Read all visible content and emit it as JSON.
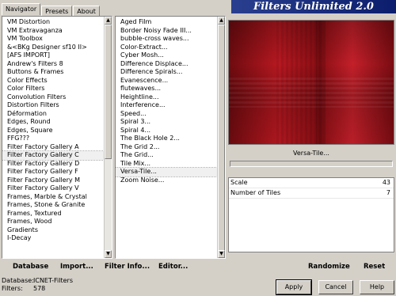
{
  "tabs": [
    "Navigator",
    "Presets",
    "About"
  ],
  "app_title": "Filters Unlimited 2.0",
  "categories": [
    "VM Distortion",
    "VM Extravaganza",
    "VM Toolbox",
    "&<BKg Designer sf10 II>",
    "[AFS IMPORT]",
    "Andrew's Filters 8",
    "Buttons & Frames",
    "Color Effects",
    "Color Filters",
    "Convolution Filters",
    "Distortion Filters",
    "Déformation",
    "Edges, Round",
    "Edges, Square",
    "FFG???",
    "Filter Factory Gallery A",
    "Filter Factory Gallery C",
    "Filter Factory Gallery D",
    "Filter Factory Gallery F",
    "Filter Factory Gallery M",
    "Filter Factory Gallery V",
    "Frames, Marble & Crystal",
    "Frames, Stone & Granite",
    "Frames, Textured",
    "Frames, Wood",
    "Gradients",
    "I-Decay"
  ],
  "categories_selected_index": 16,
  "filters": [
    "Aged Film",
    "Border Noisy Fade III...",
    "bubble-cross waves...",
    "Color-Extract...",
    "Cyber Mosh...",
    "Difference Displace...",
    "Difference Spirals...",
    "Evanescence...",
    "flutewaves...",
    "Heightline...",
    "Interference...",
    "Speed...",
    "Spiral 3...",
    "Spiral 4...",
    "The Black Hole 2...",
    "The Grid 2...",
    "The Grid...",
    "Tile Mix...",
    "Versa-Tile...",
    "Zoom Noise..."
  ],
  "filters_selected_index": 18,
  "filter_name": "Versa-Tile...",
  "params": [
    {
      "label": "Scale",
      "value": "43"
    },
    {
      "label": "Number of Tiles",
      "value": "7"
    }
  ],
  "buttons": {
    "database": "Database",
    "import": "Import...",
    "filter_info": "Filter Info...",
    "editor": "Editor...",
    "randomize": "Randomize",
    "reset": "Reset",
    "apply": "Apply",
    "cancel": "Cancel",
    "help": "Help"
  },
  "status": {
    "database_label": "Database:",
    "database_value": "ICNET-Filters",
    "filters_label": "Filters:",
    "filters_value": "578"
  }
}
